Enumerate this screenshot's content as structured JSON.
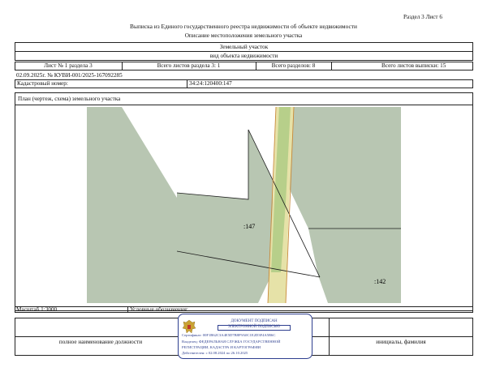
{
  "header": {
    "section_page": "Раздел 3   Лист 6",
    "title": "Выписка из Единого государственного реестра недвижимости об объекте недвижимости",
    "subtitle": "Описание местоположения земельного участка"
  },
  "object": {
    "kind": "Земельный участок",
    "kind_caption": "вид объекта недвижимости"
  },
  "sheet_info": {
    "sheet_of_section": "Лист № 1 раздела 3",
    "sheets_in_section": "Всего листов раздела 3: 1",
    "sections_total": "Всего разделов: 8",
    "sheets_total": "Всего листов выписки: 15"
  },
  "document_ref": "02.09.2025г. № КУВИ-001/2025-167092285",
  "cadastral": {
    "label": "Кадастровый номер:",
    "value": "34:24:120400:147"
  },
  "plan": {
    "label": "План (чертеж, схема) земельного участка",
    "parcel_label_main": ":147",
    "parcel_label_adjacent": ":142",
    "colors": {
      "parcel_fill": "#b8c6b2",
      "road_fill": "#e6e2a8",
      "strip_fill": "#b7cf8a",
      "boundary": "#1a1a1a",
      "road_edge": "#c98a3a"
    }
  },
  "footer": {
    "scale": "Масштаб 1:3000",
    "legend": "Условные обозначения:",
    "position_caption": "полное наименование должности",
    "name_caption": "инициалы, фамилия"
  },
  "stamp": {
    "line1": "ДОКУМЕНТ ПОДПИСАН",
    "line2": "ЭЛЕКТРОННОЙ ПОДПИСЬЮ",
    "line3": "Сертификат: 00F1B62C3A4E5D7B8F9A0C1E2D3F4A5B6C",
    "line4": "Владелец: ФЕДЕРАЛЬНАЯ СЛУЖБА ГОСУДАРСТВЕННОЙ",
    "line5": "РЕГИСТРАЦИИ, КАДАСТРА И КАРТОГРАФИИ",
    "line6": "Действителен: с 02.08.2024 по 26.10.2025",
    "color": "#2e3f8f"
  }
}
